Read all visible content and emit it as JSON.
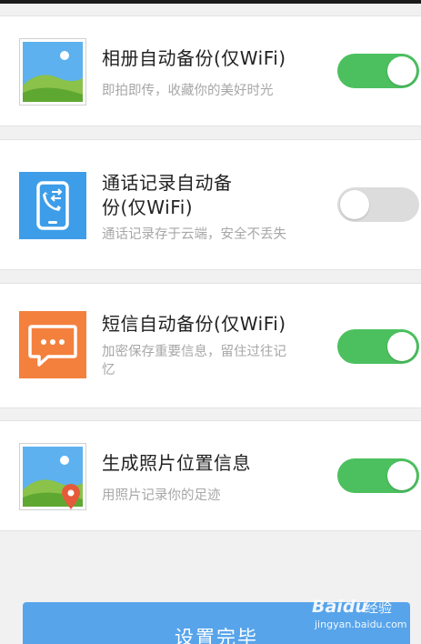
{
  "settings": [
    {
      "id": "photo-backup",
      "title": "相册自动备份(仅WiFi)",
      "subtitle": "即拍即传，收藏你的美好时光",
      "enabled": true,
      "icon": "photo-album-icon"
    },
    {
      "id": "call-log-backup",
      "title_line1": "通话记录自动备",
      "title_line2": "份(仅WiFi)",
      "subtitle": "通话记录存于云端，安全不丢失",
      "enabled": false,
      "icon": "call-log-icon"
    },
    {
      "id": "sms-backup",
      "title": "短信自动备份(仅WiFi)",
      "subtitle_line1": "加密保存重要信息，留住过往记",
      "subtitle_line2": "忆",
      "enabled": true,
      "icon": "sms-icon"
    },
    {
      "id": "photo-location",
      "title": "生成照片位置信息",
      "subtitle": "用照片记录你的足迹",
      "enabled": true,
      "icon": "photo-location-icon"
    }
  ],
  "done_button": {
    "label": "设置完毕"
  },
  "watermark": {
    "brand": "Baidu",
    "sub": "经验",
    "url": "jingyan.baidu.com"
  },
  "colors": {
    "toggle_on": "#4cc05f",
    "toggle_off": "#dcdcdc",
    "button": "#57a4ea",
    "call_icon_bg": "#3d9de8",
    "sms_icon_bg": "#f4803e",
    "background": "#f1f1f2"
  }
}
